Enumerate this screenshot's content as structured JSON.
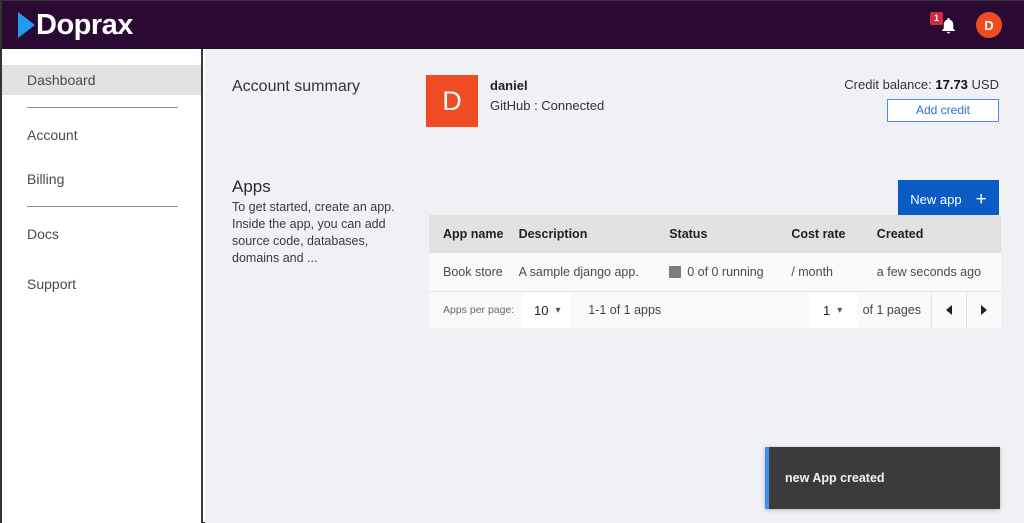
{
  "brand": {
    "name": "Doprax",
    "logo_icon": "play-triangle-icon"
  },
  "topbar": {
    "notifications": {
      "icon": "bell-icon",
      "badge_count": "1"
    },
    "avatar": {
      "initial": "D"
    }
  },
  "sidebar": {
    "items": [
      {
        "label": "Dashboard",
        "active": true
      },
      {
        "label": "Account",
        "active": false
      },
      {
        "label": "Billing",
        "active": false
      },
      {
        "label": "Docs",
        "active": false
      },
      {
        "label": "Support",
        "active": false
      }
    ]
  },
  "account_summary": {
    "title": "Account summary",
    "avatar_initial": "D",
    "username": "daniel",
    "github_status": "GitHub : Connected",
    "credit_label": "Credit balance:",
    "credit_value": "17.73",
    "credit_currency": "USD",
    "add_credit_label": "Add credit"
  },
  "apps": {
    "title": "Apps",
    "description": "To get started, create an app. Inside the app, you can add source code, databases, domains and ...",
    "new_app_label": "New app",
    "new_app_icon": "plus-icon",
    "table": {
      "columns": [
        "App name",
        "Description",
        "Status",
        "Cost rate",
        "Created"
      ],
      "rows": [
        {
          "app_name": "Book store",
          "description": "A sample django app.",
          "status_icon": "stopped-square-icon",
          "status": "0 of 0 running",
          "cost_rate": "/ month",
          "created": "a few seconds ago"
        }
      ]
    },
    "pagination": {
      "per_page_label": "Apps per page:",
      "per_page_value": "10",
      "range_text": "1-1 of 1 apps",
      "page_value": "1",
      "pages_text": "of 1 pages",
      "prev_icon": "chevron-left-icon",
      "next_icon": "chevron-right-icon"
    }
  },
  "toast": {
    "message": "new App created"
  },
  "colors": {
    "topbar": "#2a0a33",
    "accent_blue": "#0a5bc4",
    "avatar_orange": "#ef4c23",
    "badge_red": "#d42a3c",
    "toast_bg": "#3b3b3b",
    "toast_accent": "#3f8ef7",
    "main_bg": "#f0f1f5"
  }
}
